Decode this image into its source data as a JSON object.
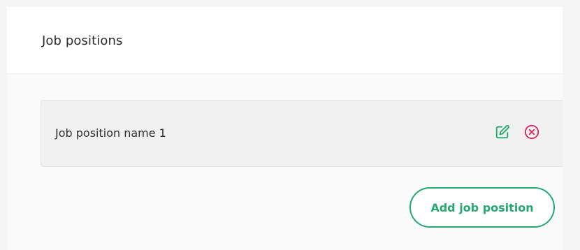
{
  "panel": {
    "title": "Job positions"
  },
  "job_positions": [
    {
      "name": "Job position name 1",
      "edit_icon": "edit-icon",
      "remove_icon": "remove-circle-x-icon"
    }
  ],
  "actions": {
    "add_label": "Add job position"
  },
  "colors": {
    "accent": "#26a873",
    "danger": "#e0245e",
    "row_bg": "#f1f1f1"
  }
}
